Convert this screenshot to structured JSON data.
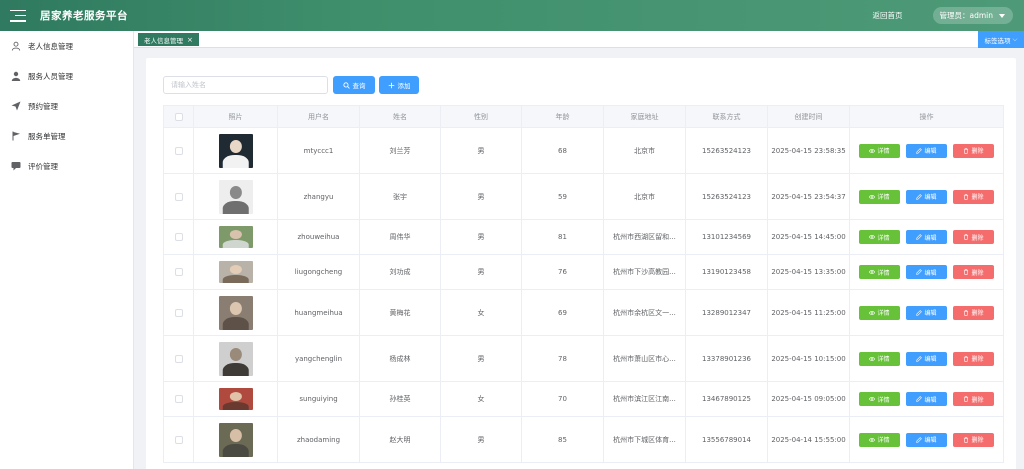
{
  "header": {
    "title": "居家养老服务平台",
    "back_home": "返回首页",
    "admin_label": "管理员：admin"
  },
  "sidebar": {
    "items": [
      {
        "label": "老人信息管理",
        "icon": "user-outline-icon"
      },
      {
        "label": "服务人员管理",
        "icon": "user-filled-icon"
      },
      {
        "label": "预约管理",
        "icon": "send-icon"
      },
      {
        "label": "服务单管理",
        "icon": "flag-icon"
      },
      {
        "label": "评价管理",
        "icon": "comment-icon"
      }
    ]
  },
  "tags": {
    "active_tag": "老人信息管理",
    "close_glyph": "×",
    "options_label": "标签选项"
  },
  "toolbar": {
    "search_placeholder": "请输入姓名",
    "query_label": "查询",
    "add_label": "添加"
  },
  "table": {
    "columns": [
      "照片",
      "用户名",
      "姓名",
      "性别",
      "年龄",
      "家庭地址",
      "联系方式",
      "创建时间",
      "操作"
    ],
    "actions": {
      "detail": "详情",
      "edit": "编辑",
      "delete": "删除"
    },
    "rows": [
      {
        "username": "mtyccc1",
        "name": "刘兰芳",
        "gender": "男",
        "age": "68",
        "address": "北京市",
        "phone": "15263524123",
        "created": "2025-04-15 23:58:35"
      },
      {
        "username": "zhangyu",
        "name": "张宇",
        "gender": "男",
        "age": "59",
        "address": "北京市",
        "phone": "15263524123",
        "created": "2025-04-15 23:54:37"
      },
      {
        "username": "zhouweihua",
        "name": "周伟华",
        "gender": "男",
        "age": "81",
        "address": "杭州市西湖区留和...",
        "phone": "13101234569",
        "created": "2025-04-15 14:45:00"
      },
      {
        "username": "liugongcheng",
        "name": "刘功成",
        "gender": "男",
        "age": "76",
        "address": "杭州市下沙高教园...",
        "phone": "13190123458",
        "created": "2025-04-15 13:35:00"
      },
      {
        "username": "huangmeihua",
        "name": "黄梅花",
        "gender": "女",
        "age": "69",
        "address": "杭州市余杭区文一...",
        "phone": "13289012347",
        "created": "2025-04-15 11:25:00"
      },
      {
        "username": "yangchenglin",
        "name": "杨成林",
        "gender": "男",
        "age": "78",
        "address": "杭州市萧山区市心...",
        "phone": "13378901236",
        "created": "2025-04-15 10:15:00"
      },
      {
        "username": "sunguiying",
        "name": "孙桂英",
        "gender": "女",
        "age": "70",
        "address": "杭州市滨江区江南...",
        "phone": "13467890125",
        "created": "2025-04-15 09:05:00"
      },
      {
        "username": "zhaodaming",
        "name": "赵大明",
        "gender": "男",
        "age": "85",
        "address": "杭州市下城区体育...",
        "phone": "13556789014",
        "created": "2025-04-14 15:55:00"
      }
    ]
  },
  "colors": {
    "header_green": "#2f7a60",
    "primary_blue": "#409eff",
    "success_green": "#67c23a",
    "danger_red": "#f56c6c"
  }
}
